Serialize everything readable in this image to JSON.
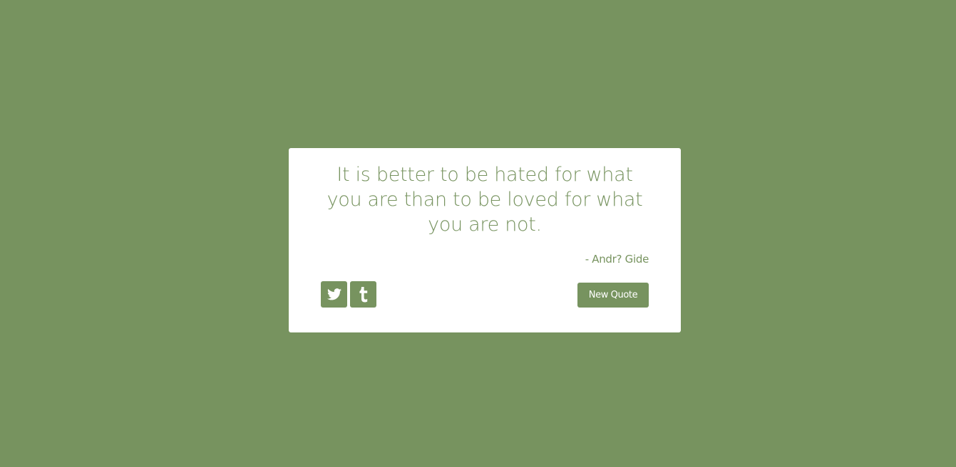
{
  "theme": {
    "background_color": "#77935f",
    "card_color": "#ffffff",
    "accent_color": "#77935f"
  },
  "quote": {
    "text": "It is better to be hated for what you are than to be loved for what you are not.",
    "author": "- Andr? Gide"
  },
  "actions": {
    "twitter_icon": "twitter-icon",
    "tumblr_icon": "tumblr-icon",
    "new_quote_label": "New Quote"
  }
}
